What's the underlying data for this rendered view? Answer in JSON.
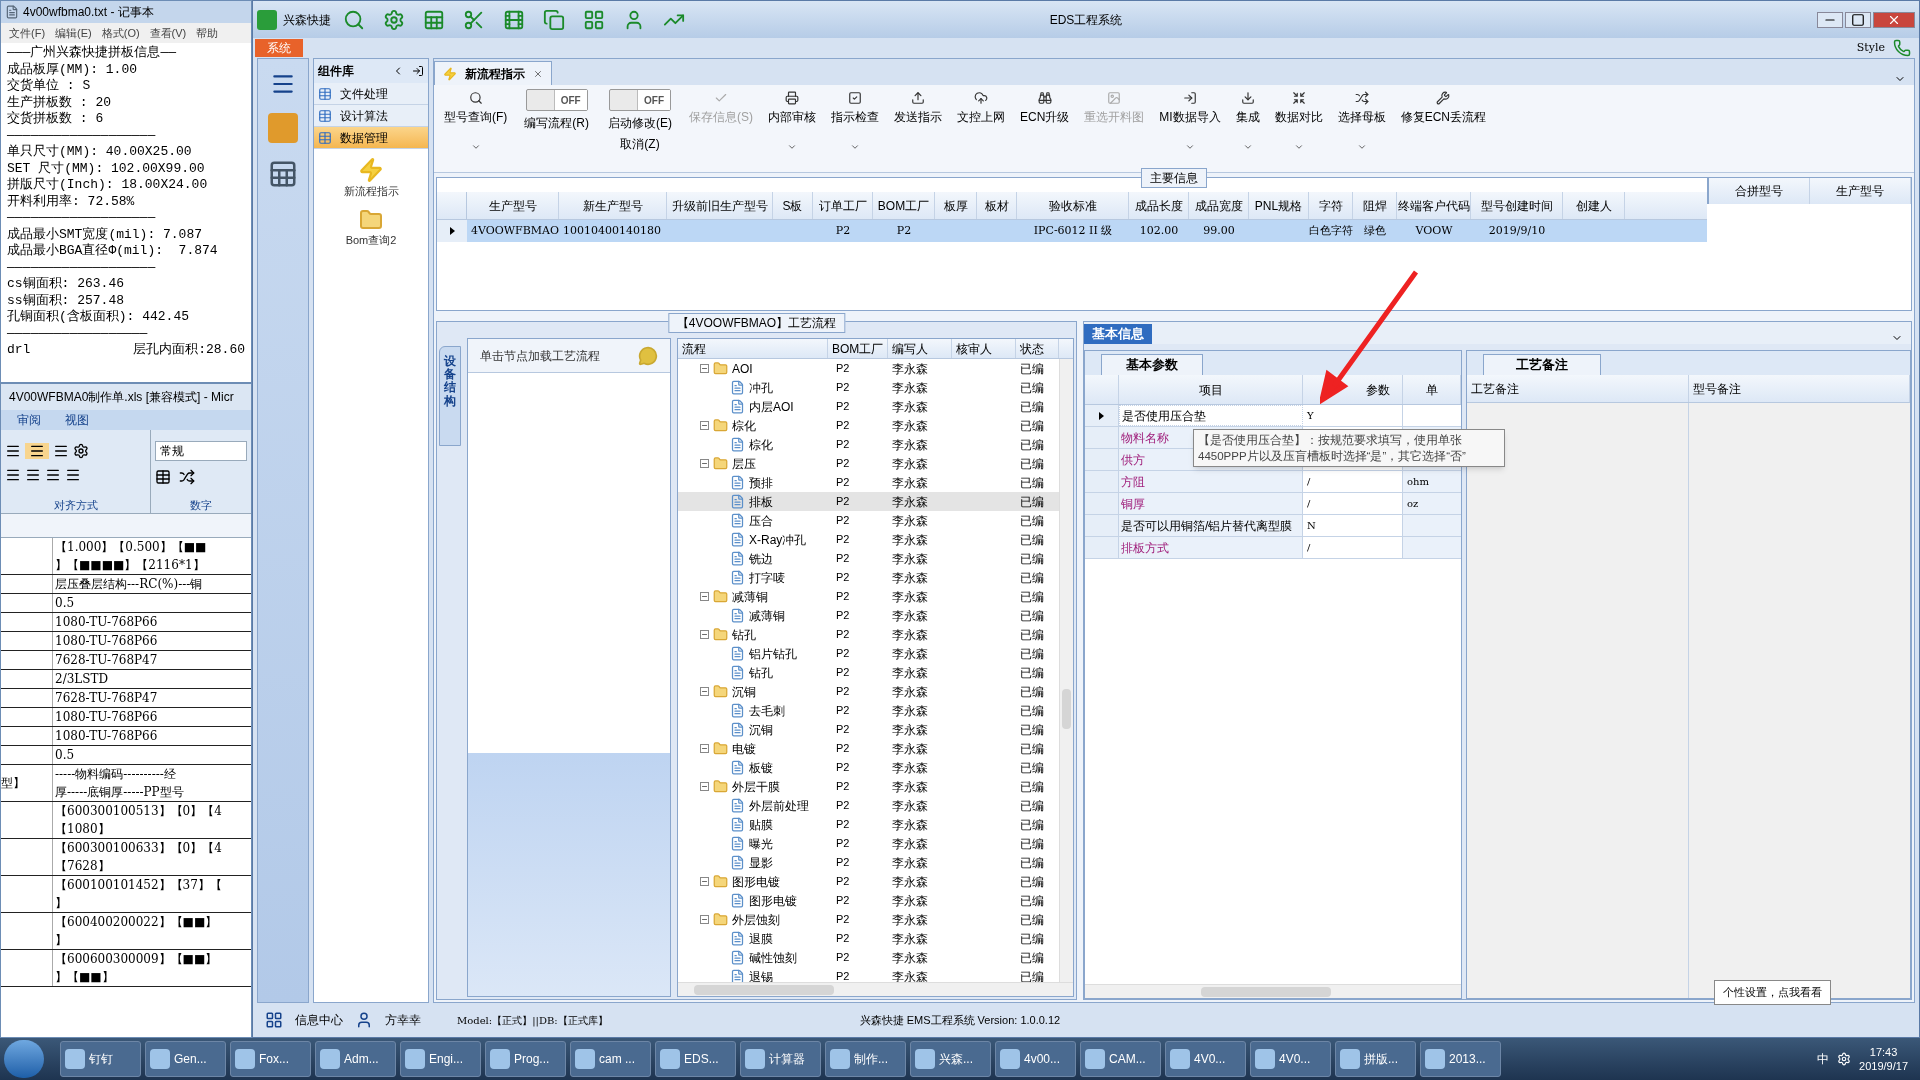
{
  "notepad": {
    "title": "4v00wfbma0.txt - 记事本",
    "menu": [
      "文件(F)",
      "编辑(E)",
      "格式(O)",
      "查看(V)",
      "帮助"
    ],
    "lines": [
      "———广州兴森快捷拼板信息——",
      "成品板厚(MM): 1.00",
      "交货单位 : S",
      "生产拼板数 : 20",
      "交货拼板数 : 6",
      "———————————————————",
      "单只尺寸(MM): 40.00X25.00",
      "SET 尺寸(MM): 102.00X99.00",
      "拼版尺寸(Inch): 18.00X24.00",
      "开料利用率: 72.58%",
      "———————————————————",
      "成品最小SMT宽度(mil): 7.087",
      "成品最小BGA直径Φ(mil):  7.874",
      "———————————————————",
      "cs铜面积: 263.46",
      "ss铜面积: 257.48",
      "孔铜面积(含板面积): 442.45",
      "——————————————————"
    ],
    "last_row": {
      "left": "drl",
      "right": "层孔内面积:28.60"
    }
  },
  "excel": {
    "title": "4V00WFBMA0制作单.xls  [兼容模式] - Micr",
    "tabs": [
      "审阅",
      "视图"
    ],
    "number_format": "常规",
    "groups": [
      "对齐方式",
      "数字"
    ],
    "rows": [
      {
        "lines": [
          "【1.000】【0.500】【■■",
          "】【■■■■】【2116*1】"
        ]
      },
      {
        "lines": [
          "层压叠层结构---RC(%)---铜"
        ]
      },
      {
        "lines": [
          "0.5"
        ]
      },
      {
        "lines": [
          "1080-TU-768P66"
        ]
      },
      {
        "lines": [
          "1080-TU-768P66"
        ]
      },
      {
        "lines": [
          "7628-TU-768P47"
        ]
      },
      {
        "lines": [
          "2/3LSTD"
        ]
      },
      {
        "lines": [
          "7628-TU-768P47"
        ]
      },
      {
        "lines": [
          "1080-TU-768P66"
        ]
      },
      {
        "lines": [
          "1080-TU-768P66"
        ]
      },
      {
        "lines": [
          "0.5"
        ]
      },
      {
        "left": "型】",
        "lines": [
          "-----物料编码----------经",
          "厚-----底铜厚-----PP型号"
        ]
      },
      {
        "lines": [
          "【600300100513】【0】【4",
          "【1080】"
        ]
      },
      {
        "lines": [
          "【600300100633】【0】【4",
          "【7628】"
        ]
      },
      {
        "lines": [
          "【600100101452】【37】【",
          "】"
        ]
      },
      {
        "lines": [
          "【600400200022】【■■】",
          "】"
        ]
      },
      {
        "lines": [
          "【600600300009】【■■】",
          "】【■■】"
        ]
      }
    ]
  },
  "window": {
    "app_name": "兴森快捷",
    "title": "EDS工程系统",
    "system_tab": "系统",
    "style_menu": "Style"
  },
  "sidebar": {
    "title": "组件库",
    "items": [
      {
        "label": "文件处理",
        "selected": false
      },
      {
        "label": "设计算法",
        "selected": false
      },
      {
        "label": "数据管理",
        "selected": true
      }
    ],
    "tools": [
      "新流程指示",
      "Bom查询2"
    ]
  },
  "doc_tab": {
    "label": "新流程指示"
  },
  "toolbar": [
    {
      "kind": "button",
      "label": "型号查询(F)",
      "dropdown": true,
      "disabled": false
    },
    {
      "kind": "toggle",
      "label": "编写流程(R)",
      "state_text": "OFF",
      "on": false
    },
    {
      "kind": "toggle",
      "label": "启动修改(E)",
      "sublabel": "取消(Z)",
      "state_text": "OFF",
      "on": false
    },
    {
      "kind": "button",
      "label": "保存信息(S)",
      "dropdown": false,
      "disabled": true
    },
    {
      "kind": "button",
      "label": "内部审核",
      "dropdown": true,
      "disabled": false
    },
    {
      "kind": "button",
      "label": "指示检查",
      "dropdown": true,
      "disabled": false
    },
    {
      "kind": "button",
      "label": "发送指示",
      "dropdown": false,
      "disabled": false
    },
    {
      "kind": "button",
      "label": "文控上网",
      "dropdown": false,
      "disabled": false
    },
    {
      "kind": "button",
      "label": "ECN升级",
      "dropdown": false,
      "disabled": false
    },
    {
      "kind": "button",
      "label": "重选开料图",
      "dropdown": false,
      "disabled": true
    },
    {
      "kind": "button",
      "label": "MI数据导入",
      "dropdown": true,
      "disabled": false
    },
    {
      "kind": "button",
      "label": "集成",
      "dropdown": true,
      "disabled": false
    },
    {
      "kind": "button",
      "label": "数据对比",
      "dropdown": true,
      "disabled": false
    },
    {
      "kind": "button",
      "label": "选择母板",
      "dropdown": true,
      "disabled": false
    },
    {
      "kind": "button",
      "label": "修复ECN丢流程",
      "dropdown": false,
      "disabled": false
    }
  ],
  "main_info": {
    "title": "主要信息",
    "columns": [
      "生产型号",
      "新生产型号",
      "升级前旧生产型号",
      "S板",
      "订单工厂",
      "BOM工厂",
      "板厚",
      "板材",
      "验收标准",
      "成品长度",
      "成品宽度",
      "PNL规格",
      "字符",
      "阻焊",
      "终端客户代码",
      "型号创建时间",
      "创建人"
    ],
    "rows": [
      {
        "selected": true,
        "cells": [
          "4VOOWFBMAO",
          "10010400140180",
          null,
          null,
          "P2",
          "P2",
          null,
          null,
          "IPC-6012 II 级",
          "102.00",
          "99.00",
          null,
          "白色字符",
          "绿色",
          "VOOW",
          "2019/9/10",
          null
        ]
      }
    ],
    "side_columns": [
      "合拼型号",
      "生产型号"
    ]
  },
  "process": {
    "title": "【4VOOWFBMAO】工艺流程",
    "side_tab": "设备结构",
    "hint": "单击节点加载工艺流程",
    "columns": [
      "流程",
      "BOM工厂",
      "编写人",
      "核审人",
      "状态"
    ],
    "tree": [
      {
        "label": "AOI",
        "bom": "P2",
        "writer": "李永森",
        "status": "已编",
        "selected": false,
        "expanded": true,
        "children": [
          {
            "label": "冲孔",
            "bom": "P2",
            "writer": "李永森",
            "status": "已编",
            "selected": false
          },
          {
            "label": "内层AOI",
            "bom": "P2",
            "writer": "李永森",
            "status": "已编",
            "selected": false
          }
        ]
      },
      {
        "label": "棕化",
        "bom": "P2",
        "writer": "李永森",
        "status": "已编",
        "selected": false,
        "expanded": true,
        "children": [
          {
            "label": "棕化",
            "bom": "P2",
            "writer": "李永森",
            "status": "已编",
            "selected": false
          }
        ]
      },
      {
        "label": "层压",
        "bom": "P2",
        "writer": "李永森",
        "status": "已编",
        "selected": false,
        "expanded": true,
        "children": [
          {
            "label": "预排",
            "bom": "P2",
            "writer": "李永森",
            "status": "已编",
            "selected": false
          },
          {
            "label": "排板",
            "bom": "P2",
            "writer": "李永森",
            "status": "已编",
            "selected": true
          },
          {
            "label": "压合",
            "bom": "P2",
            "writer": "李永森",
            "status": "已编",
            "selected": false
          },
          {
            "label": "X-Ray冲孔",
            "bom": "P2",
            "writer": "李永森",
            "status": "已编",
            "selected": false
          },
          {
            "label": "铣边",
            "bom": "P2",
            "writer": "李永森",
            "status": "已编",
            "selected": false
          },
          {
            "label": "打字唛",
            "bom": "P2",
            "writer": "李永森",
            "status": "已编",
            "selected": false
          }
        ]
      },
      {
        "label": "减薄铜",
        "bom": "P2",
        "writer": "李永森",
        "status": "已编",
        "selected": false,
        "expanded": true,
        "children": [
          {
            "label": "减薄铜",
            "bom": "P2",
            "writer": "李永森",
            "status": "已编",
            "selected": false
          }
        ]
      },
      {
        "label": "钻孔",
        "bom": "P2",
        "writer": "李永森",
        "status": "已编",
        "selected": false,
        "expanded": true,
        "children": [
          {
            "label": "铝片钻孔",
            "bom": "P2",
            "writer": "李永森",
            "status": "已编",
            "selected": false
          },
          {
            "label": "钻孔",
            "bom": "P2",
            "writer": "李永森",
            "status": "已编",
            "selected": false
          }
        ]
      },
      {
        "label": "沉铜",
        "bom": "P2",
        "writer": "李永森",
        "status": "已编",
        "selected": false,
        "expanded": true,
        "children": [
          {
            "label": "去毛刺",
            "bom": "P2",
            "writer": "李永森",
            "status": "已编",
            "selected": false
          },
          {
            "label": "沉铜",
            "bom": "P2",
            "writer": "李永森",
            "status": "已编",
            "selected": false
          }
        ]
      },
      {
        "label": "电镀",
        "bom": "P2",
        "writer": "李永森",
        "status": "已编",
        "selected": false,
        "expanded": true,
        "children": [
          {
            "label": "板镀",
            "bom": "P2",
            "writer": "李永森",
            "status": "已编",
            "selected": false
          }
        ]
      },
      {
        "label": "外层干膜",
        "bom": "P2",
        "writer": "李永森",
        "status": "已编",
        "selected": false,
        "expanded": true,
        "children": [
          {
            "label": "外层前处理",
            "bom": "P2",
            "writer": "李永森",
            "status": "已编",
            "selected": false
          },
          {
            "label": "贴膜",
            "bom": "P2",
            "writer": "李永森",
            "status": "已编",
            "selected": false
          },
          {
            "label": "曝光",
            "bom": "P2",
            "writer": "李永森",
            "status": "已编",
            "selected": false
          },
          {
            "label": "显影",
            "bom": "P2",
            "writer": "李永森",
            "status": "已编",
            "selected": false
          }
        ]
      },
      {
        "label": "图形电镀",
        "bom": "P2",
        "writer": "李永森",
        "status": "已编",
        "selected": false,
        "expanded": true,
        "children": [
          {
            "label": "图形电镀",
            "bom": "P2",
            "writer": "李永森",
            "status": "已编",
            "selected": false
          }
        ]
      },
      {
        "label": "外层蚀刻",
        "bom": "P2",
        "writer": "李永森",
        "status": "已编",
        "selected": false,
        "expanded": true,
        "children": [
          {
            "label": "退膜",
            "bom": "P2",
            "writer": "李永森",
            "status": "已编",
            "selected": false
          },
          {
            "label": "碱性蚀刻",
            "bom": "P2",
            "writer": "李永森",
            "status": "已编",
            "selected": false
          },
          {
            "label": "退锡",
            "bom": "P2",
            "writer": "李永森",
            "status": "已编",
            "selected": false
          }
        ]
      }
    ]
  },
  "basic_info": {
    "title": "基本信息",
    "params_tab": "基本参数",
    "columns": [
      "项目",
      "参数",
      "单"
    ],
    "rows": [
      {
        "item": "是否使用压合垫",
        "value": "Y",
        "kind": "plain",
        "selected": true
      },
      {
        "item": "物料名称",
        "kind": "marked",
        "selected": false
      },
      {
        "item": "供方",
        "kind": "marked",
        "selected": false
      },
      {
        "item": "方阻",
        "value": "/",
        "unit": "ohm",
        "kind": "marked",
        "selected": false
      },
      {
        "item": "铜厚",
        "value": "/",
        "unit": "oz",
        "kind": "marked",
        "selected": false
      },
      {
        "item": "是否可以用铜箔/铝片替代离型膜",
        "value": "N",
        "kind": "plain",
        "selected": false
      },
      {
        "item": "排板方式",
        "value": "/",
        "kind": "marked",
        "selected": false
      }
    ],
    "tooltip": "【是否使用压合垫】：按规范要求填写，使用单张4450PPP片以及压盲槽板时选择“是”，其它选择“否”",
    "notes_tab": "工艺备注",
    "notes_columns": [
      "工艺备注",
      "型号备注"
    ]
  },
  "status_bar": {
    "info_center": "信息中心",
    "user": "方幸幸",
    "model": "Model:【正式】||DB:【正式库】",
    "version": "兴森快捷 EMS工程系统 Version: 1.0.0.12"
  },
  "popup": "个性设置，点我看看",
  "taskbar": {
    "items": [
      "钉钉",
      "Gen...",
      "Fox...",
      "Adm...",
      "Engi...",
      "Prog...",
      "cam ...",
      "EDS...",
      "计算器",
      "制作...",
      "兴森...",
      "4v00...",
      "CAM...",
      "4V0...",
      "4V0...",
      "拼版...",
      "2013..."
    ],
    "input_method": "中",
    "time": "17:43",
    "date": "2019/9/17"
  }
}
